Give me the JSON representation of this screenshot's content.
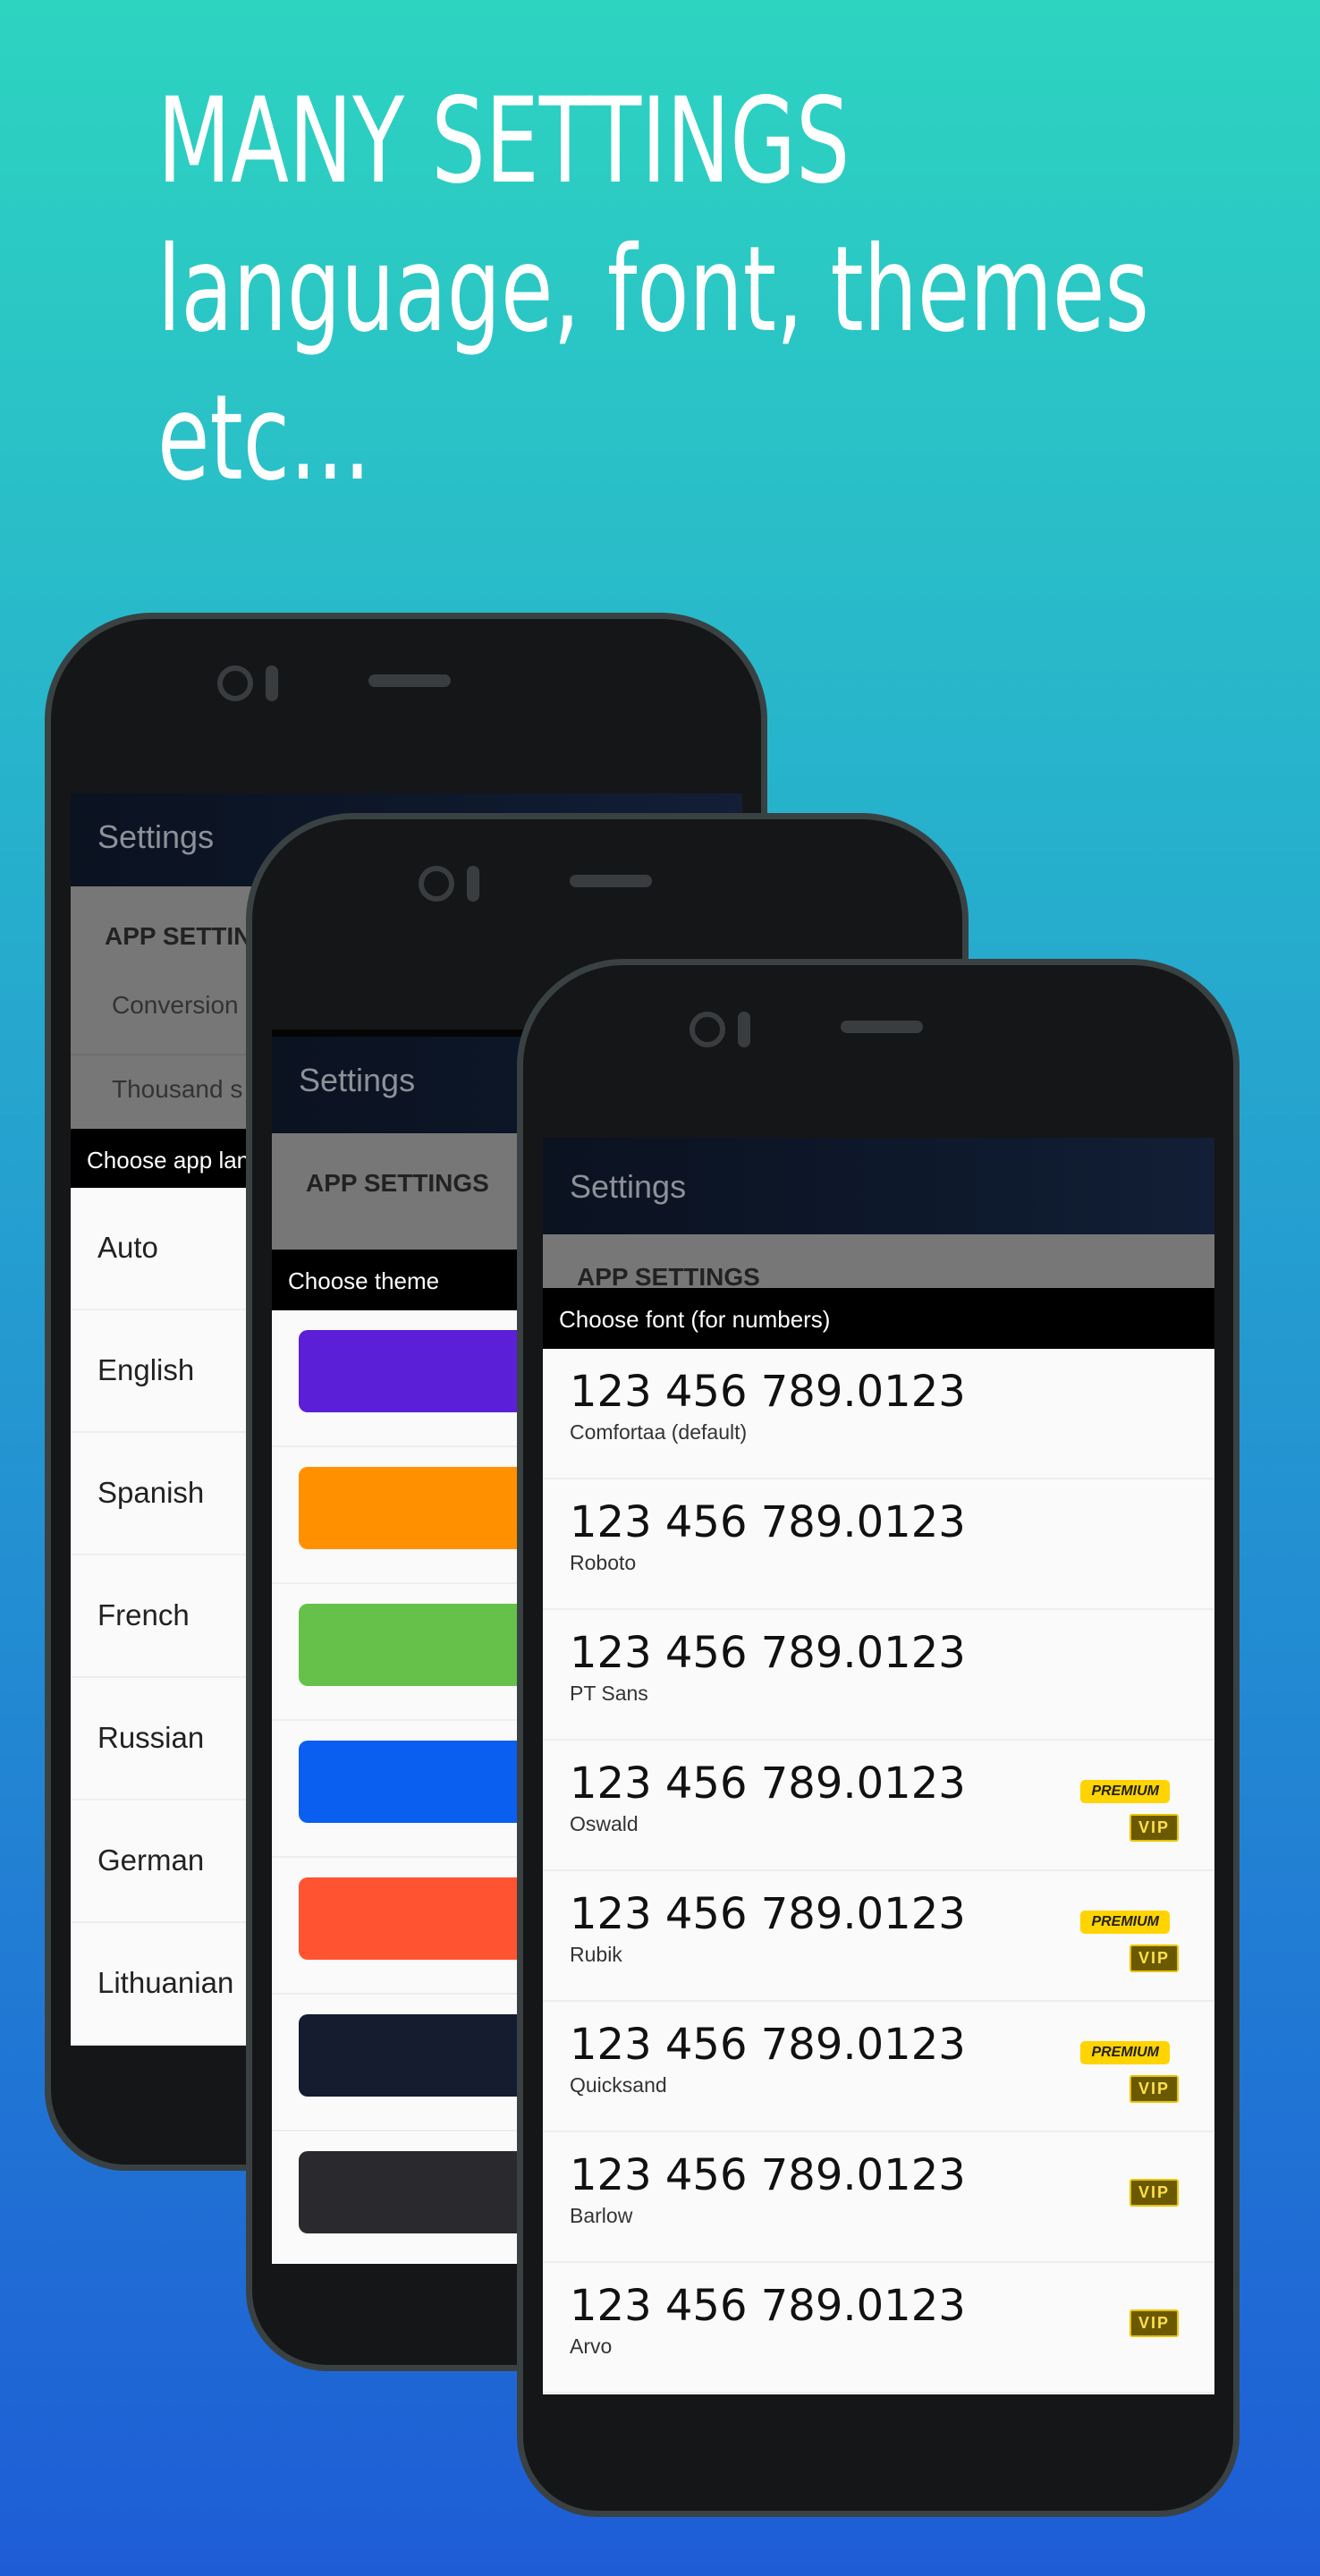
{
  "headline": [
    "MANY SETTINGS",
    "language, font, themes",
    "etc..."
  ],
  "settings_title": "Settings",
  "app_settings_label": "APP SETTINGS",
  "phone1": {
    "settings_items": [
      "Conversion",
      "Thousand s"
    ],
    "dialog_title": "Choose app language",
    "languages": [
      "Auto",
      "English",
      "Spanish",
      "French",
      "Russian",
      "German",
      "Lithuanian"
    ]
  },
  "phone2": {
    "dialog_title": "Choose theme",
    "themes": [
      "#5b1fd8",
      "#ff9100",
      "#66c14a",
      "#0a5ef0",
      "#ff5331",
      "#151c2f",
      "#2a2a2e"
    ]
  },
  "phone3": {
    "dialog_title": "Choose font (for numbers)",
    "sample": "123 456 789.0123",
    "fonts": [
      {
        "name": "Comfortaa (default)",
        "premium": false,
        "vip": false
      },
      {
        "name": "Roboto",
        "premium": false,
        "vip": false
      },
      {
        "name": "PT Sans",
        "premium": false,
        "vip": false
      },
      {
        "name": "Oswald",
        "premium": true,
        "vip": true
      },
      {
        "name": "Rubik",
        "premium": true,
        "vip": true
      },
      {
        "name": "Quicksand",
        "premium": true,
        "vip": true
      },
      {
        "name": "Barlow",
        "premium": false,
        "vip": true
      },
      {
        "name": "Arvo",
        "premium": false,
        "vip": true
      }
    ],
    "premium_label": "PREMIUM",
    "vip_label": "VIP"
  }
}
